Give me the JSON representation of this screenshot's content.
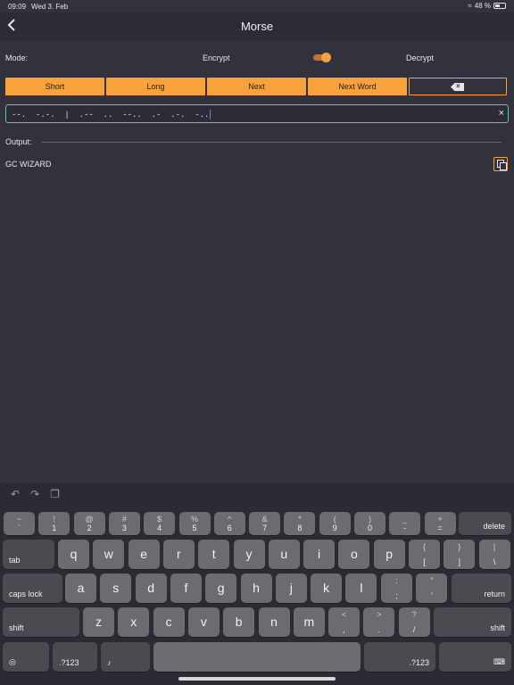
{
  "status": {
    "time": "09:09",
    "date": "Wed 3. Feb",
    "battery": "48 %"
  },
  "app_bar": {
    "title": "Morse"
  },
  "mode": {
    "label": "Mode:",
    "encrypt": "Encrypt",
    "decrypt": "Decrypt"
  },
  "buttons": {
    "short": "Short",
    "long": "Long",
    "next": "Next",
    "next_word": "Next Word"
  },
  "input": {
    "value": "--.  -.-.  |  .--  ..  --..  .-  .-.  -.."
  },
  "output": {
    "label": "Output:",
    "value": "GC WIZARD"
  },
  "keyboard": {
    "row1": [
      {
        "up": "~",
        "down": "`"
      },
      {
        "up": "!",
        "down": "1"
      },
      {
        "up": "@",
        "down": "2"
      },
      {
        "up": "#",
        "down": "3"
      },
      {
        "up": "$",
        "down": "4"
      },
      {
        "up": "%",
        "down": "5"
      },
      {
        "up": "^",
        "down": "6"
      },
      {
        "up": "&",
        "down": "7"
      },
      {
        "up": "*",
        "down": "8"
      },
      {
        "up": "(",
        "down": "9"
      },
      {
        "up": ")",
        "down": "0"
      },
      {
        "up": "_",
        "down": "-"
      },
      {
        "up": "+",
        "down": "="
      }
    ],
    "delete": "delete",
    "tab": "tab",
    "row2": [
      "q",
      "w",
      "e",
      "r",
      "t",
      "y",
      "u",
      "i",
      "o",
      "p"
    ],
    "row2_sym": [
      {
        "up": "{",
        "down": "["
      },
      {
        "up": "}",
        "down": "]"
      },
      {
        "up": "|",
        "down": "\\"
      }
    ],
    "caps": "caps lock",
    "row3": [
      "a",
      "s",
      "d",
      "f",
      "g",
      "h",
      "j",
      "k",
      "l"
    ],
    "row3_sym": [
      {
        "up": ":",
        "down": ";"
      },
      {
        "up": "\"",
        "down": "'"
      }
    ],
    "return": "return",
    "shift": "shift",
    "row4": [
      "z",
      "x",
      "c",
      "v",
      "b",
      "n",
      "m"
    ],
    "row4_sym": [
      {
        "up": "<",
        "down": ","
      },
      {
        "up": ">",
        "down": "."
      },
      {
        "up": "?",
        "down": "/"
      }
    ],
    "numbers": ".?123"
  }
}
